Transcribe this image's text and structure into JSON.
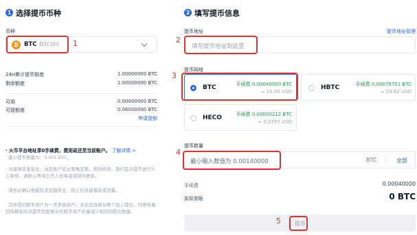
{
  "left": {
    "step_no": "1",
    "title": "选择提币币种",
    "currency_label": "币种",
    "currency": {
      "symbol": "BTC",
      "name": "Bitcoin"
    },
    "stats": [
      {
        "label": "24H累计提币额度",
        "value": "1.00000000 BTC"
      },
      {
        "label": "剩余额度",
        "value": "1.00000000 BTC"
      }
    ],
    "balances": [
      {
        "label": "可用",
        "value": "0.00000000 BTC"
      },
      {
        "label": "可提额度",
        "value": "0.06000000 BTC"
      }
    ],
    "apply_link": "申请提额",
    "notice_main": "· 火币平台地址享0手续费，费用返还至当前账户。",
    "notice_link": "了解详情 >",
    "notes": [
      "· 最小提币数量为：0.001 BTC。",
      "· 为保障资金安全，当您账户安全策略变更、密码修改、我们会对提币进行人工审核，请耐心等待工作人员电话或邮件联系。",
      "· 请务必确认电脑及浏览器安全，防止信息被篡改或泄露。",
      "· 您所提的数字资产为一币多链资产，无论您选择从哪个链上提出，均意味着您所拥有的该提币页面展示的数字资产总量减少相应的提出数量。"
    ]
  },
  "right": {
    "step_no": "2",
    "title": "填写提币信息",
    "address_label": "提币地址",
    "address_manage": "提币地址管理",
    "address_placeholder": "填写提币地址到这里",
    "network_label": "提币网络",
    "networks": [
      {
        "name": "BTC",
        "fee": "手续费 0.00040000 BTC",
        "usd": "≈ 15.05 USD",
        "selected": true
      },
      {
        "name": "HBTC",
        "fee": "手续费 0.00078701 BTC",
        "usd": "≈ 29.62 USD",
        "selected": false
      },
      {
        "name": "HECO",
        "fee": "手续费 0.00000212 BTC",
        "usd": "≈ 0.0797 USD",
        "selected": false
      }
    ],
    "amount_label": "提币数量",
    "amount_placeholder": "最小输入数值为 0.00140000",
    "amount_unit": "BTC",
    "amount_all": "全部",
    "fee_label": "手续费",
    "fee_value": "0.00040000",
    "actual_label": "实际到账",
    "actual_value": "0 BTC",
    "submit_label": "提币"
  },
  "annotations": [
    "1",
    "2",
    "3",
    "4",
    "5"
  ],
  "colors": {
    "accent": "#2a66e8",
    "annotation_red": "#e03131",
    "fee_green": "#18a058",
    "btc_orange": "#f7931a"
  }
}
